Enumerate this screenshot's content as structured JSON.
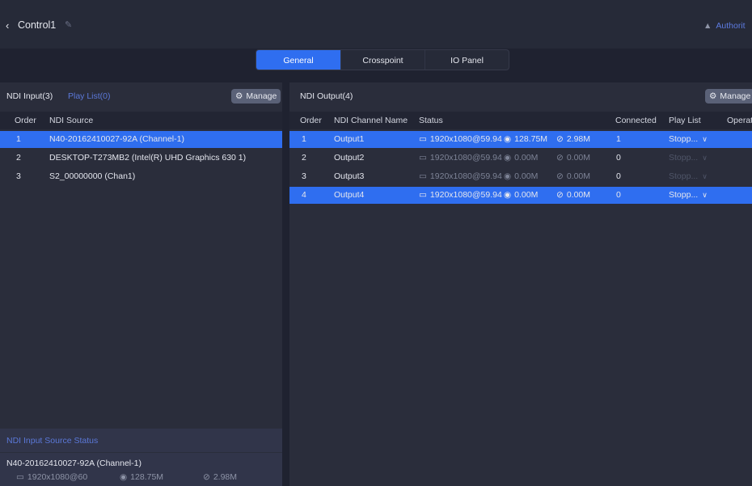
{
  "app": {
    "back_icon": "chevron-left-icon",
    "title": "Control1",
    "edit_icon": "pencil-icon",
    "authority_label": "Authorit",
    "user_icon": "user-icon"
  },
  "tabs": [
    {
      "label": "General",
      "active": true
    },
    {
      "label": "Crosspoint",
      "active": false
    },
    {
      "label": "IO Panel",
      "active": false
    }
  ],
  "left": {
    "tab_inputs": "NDI Input(3)",
    "tab_playlist": "Play List(0)",
    "manage_label": "Manage",
    "columns": [
      "Order",
      "NDI Source"
    ],
    "rows": [
      {
        "order": "1",
        "source": "N40-20162410027-92A (Channel-1)",
        "selected": true
      },
      {
        "order": "2",
        "source": "DESKTOP-T273MB2 (Intel(R) UHD Graphics 630 1)",
        "selected": false
      },
      {
        "order": "3",
        "source": "S2_00000000 (Chan1)",
        "selected": false
      }
    ],
    "status": {
      "header": "NDI Input Source Status",
      "source": "N40-20162410027-92A (Channel-1)",
      "resolution": "1920x1080@60",
      "bitrate": "128.75M",
      "other": "2.98M"
    }
  },
  "right": {
    "title": "NDI Output(4)",
    "manage_label": "Manage",
    "columns": [
      "Order",
      "NDI Channel Name",
      "Status",
      "Connected",
      "Play List",
      "Operat"
    ],
    "rows": [
      {
        "order": "1",
        "name": "Output1",
        "res": "1920x1080@59.94",
        "bitrate": "128.75M",
        "other": "2.98M",
        "connected": "1",
        "playlist": "Stopp...",
        "selected": true,
        "dim": false
      },
      {
        "order": "2",
        "name": "Output2",
        "res": "1920x1080@59.94",
        "bitrate": "0.00M",
        "other": "0.00M",
        "connected": "0",
        "playlist": "Stopp...",
        "selected": false,
        "dim": true
      },
      {
        "order": "3",
        "name": "Output3",
        "res": "1920x1080@59.94",
        "bitrate": "0.00M",
        "other": "0.00M",
        "connected": "0",
        "playlist": "Stopp...",
        "selected": false,
        "dim": true
      },
      {
        "order": "4",
        "name": "Output4",
        "res": "1920x1080@59.94",
        "bitrate": "0.00M",
        "other": "0.00M",
        "connected": "0",
        "playlist": "Stopp...",
        "selected": true,
        "dim": false
      }
    ]
  },
  "colors": {
    "accent": "#2f6ef0",
    "background": "#1f2230",
    "panel": "#2a2d3b",
    "link": "#5b78d8"
  }
}
